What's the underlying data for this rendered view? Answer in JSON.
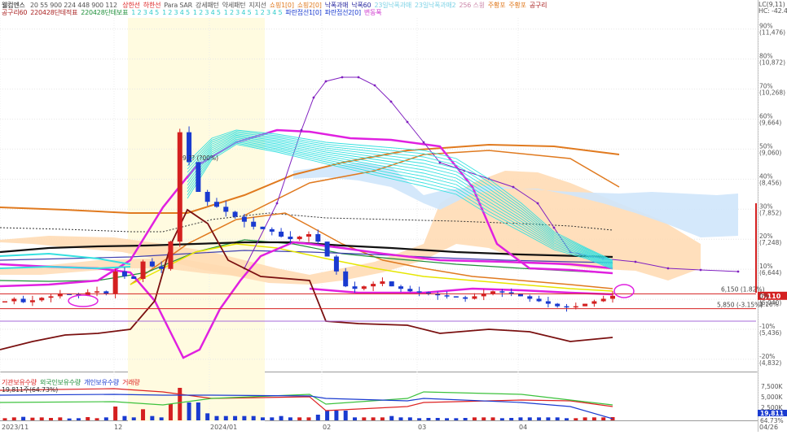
{
  "header": {
    "title": "웰컴엔스",
    "settings_text": "20 55 900 224 448 900 112",
    "legend_row1": [
      {
        "text": "상한선",
        "color": "#d22"
      },
      {
        "text": "하한선",
        "color": "#d22"
      },
      {
        "text": "Para SAR",
        "color": "#555"
      },
      {
        "text": "강세패턴",
        "color": "#555"
      },
      {
        "text": "약세패턴",
        "color": "#555"
      },
      {
        "text": "지지선",
        "color": "#555"
      },
      {
        "text": "쇼핑1[0]",
        "color": "#e07a1f"
      },
      {
        "text": "쇼핑2[0]",
        "color": "#e07a1f"
      },
      {
        "text": "낙폭과매",
        "color": "#2a2aa0"
      },
      {
        "text": "낙폭60",
        "color": "#2a2aa0"
      },
      {
        "text": "23일낙폭과매",
        "color": "#7fd3e6"
      },
      {
        "text": "23일낙폭과매2",
        "color": "#7fd3e6"
      },
      {
        "text": "256 스윙",
        "color": "#c8a"
      },
      {
        "text": "주황포",
        "color": "#e07a1f"
      },
      {
        "text": "주황포",
        "color": "#e07a1f"
      },
      {
        "text": "공구리",
        "color": "#a22"
      }
    ],
    "legend_row2": [
      {
        "text": "공구리60",
        "color": "#a22"
      },
      {
        "text": "220428단테적표",
        "color": "#a22"
      },
      {
        "text": "220428단테보표",
        "color": "#1e8f3a"
      },
      {
        "text": "1 2 3 4 5",
        "color": "#3cc"
      },
      {
        "text": "1 2 3 4 5",
        "color": "#3cc"
      },
      {
        "text": "1 2 3 4 5",
        "color": "#3cc"
      },
      {
        "text": "1 2 3 4 5",
        "color": "#3cc"
      },
      {
        "text": "1 2 3 4 5",
        "color": "#3cc"
      },
      {
        "text": "파란접선1[0]",
        "color": "#1a3bd0"
      },
      {
        "text": "파란접선2[0]",
        "color": "#1a3bd0"
      },
      {
        "text": "변동폭",
        "color": "#c3c"
      }
    ],
    "top_right_text": "LC(9,11)",
    "top_right_text2": "HC: -42.47"
  },
  "price_panel": {
    "right_axis": [
      {
        "pct": "90%",
        "price": "(11,476)"
      },
      {
        "pct": "80%",
        "price": "(10,872)"
      },
      {
        "pct": "70%",
        "price": "(10,268)"
      },
      {
        "pct": "60%",
        "price": "(9,664)"
      },
      {
        "pct": "50%",
        "price": "(9,060)"
      },
      {
        "pct": "40%",
        "price": "(8,456)"
      },
      {
        "pct": "30%",
        "price": "(7,852)"
      },
      {
        "pct": "20%",
        "price": "(7,248)"
      },
      {
        "pct": "10%",
        "price": "(6,644)"
      },
      {
        "pct": "0%",
        "price": "(6,040)"
      },
      {
        "pct": "-10%",
        "price": "(5,436)"
      },
      {
        "pct": "-20%",
        "price": "(4,832)"
      }
    ],
    "current_price": "6,110",
    "current_pct": "1.16%",
    "line_label_upper": "6,150 (1.82%)",
    "line_label_lower": "5,850 (-3.15%)",
    "annotation": "9,?? (?00%)"
  },
  "volume_panel": {
    "legend": [
      {
        "text": "기관보유수량",
        "color": "#d22"
      },
      {
        "text": "외국인보유수량",
        "color": "#1e8f3a"
      },
      {
        "text": "개인보유수량",
        "color": "#1a3bd0"
      },
      {
        "text": "거래량",
        "color": "#d22"
      }
    ],
    "value_text": "19,811주(64.73%)",
    "right_axis": [
      "7,500K",
      "5,000K",
      "2,500K"
    ],
    "badge_value": "19,811",
    "badge_pct": "64.73%"
  },
  "x_axis": {
    "labels": [
      "2023/11",
      "12",
      "2024/01",
      "02",
      "03",
      "04",
      "04/26"
    ]
  },
  "colors": {
    "up": "#d42020",
    "down": "#1a3bd0",
    "cloud": "#ffd9b0",
    "cloud_blue": "#cfe6fb",
    "highlight": "#fffbe0",
    "magenta": "#e020e0",
    "purple": "#8020c0",
    "orange": "#e07a1f",
    "cyan": "#35e0e0",
    "black": "#111111",
    "brown": "#7a1010"
  },
  "chart_data": {
    "type": "line",
    "title": "",
    "ylabel": "",
    "xlabel": "",
    "ylim": [
      4700,
      11700
    ],
    "x_axis_labels": [
      "2023/11",
      "12",
      "2024/01",
      "02",
      "03",
      "04",
      "04/26"
    ],
    "candles_close_approx": [
      6000,
      6050,
      5980,
      6020,
      6070,
      6100,
      6150,
      6140,
      6120,
      6180,
      6200,
      6150,
      6600,
      6500,
      6450,
      6800,
      6700,
      6650,
      7200,
      9400,
      8800,
      8200,
      8000,
      7900,
      7800,
      7700,
      7600,
      7500,
      7450,
      7400,
      7300,
      7250,
      7300,
      7350,
      7200,
      6900,
      6600,
      6300,
      6250,
      6300,
      6350,
      6400,
      6300,
      6250,
      6200,
      6180,
      6150,
      6120,
      6100,
      6080,
      6050,
      6100,
      6150,
      6200,
      6180,
      6150,
      6100,
      6050,
      6000,
      5950,
      5900,
      5880,
      5900,
      5950,
      6000,
      6050,
      6110
    ],
    "reference_levels": [
      6150,
      5850
    ],
    "current_price": 6110,
    "current_change_pct": 1.16
  }
}
